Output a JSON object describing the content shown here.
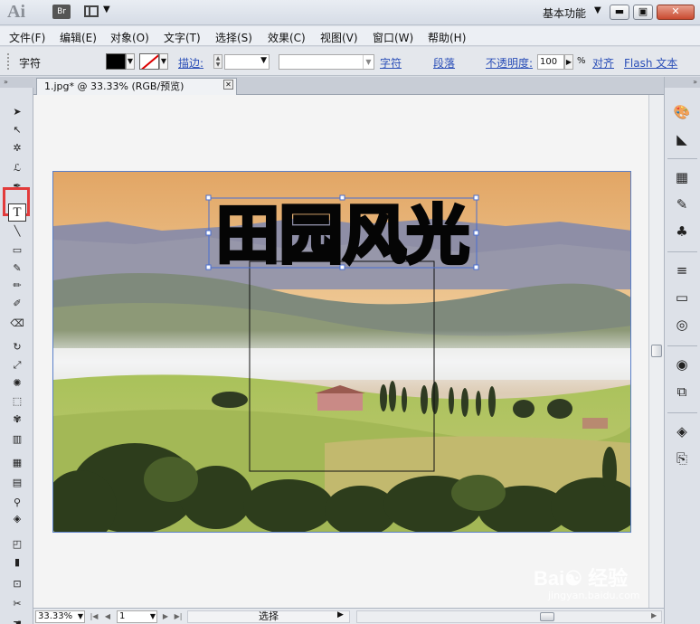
{
  "titlebar": {
    "app_logo": "Ai",
    "bridge_button": "Br",
    "layout_icon": "arrange-documents-icon",
    "workspace": "基本功能",
    "workspace_arrow": "▼",
    "minimize": "▬",
    "maximize": "▣",
    "close": "✕"
  },
  "menubar": {
    "items": [
      "文件(F)",
      "编辑(E)",
      "对象(O)",
      "文字(T)",
      "选择(S)",
      "效果(C)",
      "视图(V)",
      "窗口(W)",
      "帮助(H)"
    ]
  },
  "controlbar": {
    "label": "字符",
    "fill_color": "#000000",
    "stroke_color": "none",
    "stroke_label": "描边:",
    "stroke_weight": "",
    "font_family": "",
    "char_link": "字符",
    "para_link": "段落",
    "opacity_label": "不透明度:",
    "opacity_value": "100",
    "opacity_unit": "%",
    "align_link": "对齐",
    "flash_link": "Flash 文本"
  },
  "tools": {
    "header": "»",
    "items": [
      {
        "name": "selection-tool",
        "glyph": "➤"
      },
      {
        "name": "direct-selection-tool",
        "glyph": "↖"
      },
      {
        "name": "magic-wand-tool",
        "glyph": "✲"
      },
      {
        "name": "lasso-tool",
        "glyph": "ℒ"
      },
      {
        "name": "pen-tool",
        "glyph": "✒"
      },
      {
        "name": "type-tool",
        "glyph": "T"
      },
      {
        "name": "line-segment-tool",
        "glyph": "╲"
      },
      {
        "name": "rectangle-tool",
        "glyph": "▭"
      },
      {
        "name": "paintbrush-tool",
        "glyph": "✎"
      },
      {
        "name": "pencil-tool",
        "glyph": "✏"
      },
      {
        "name": "blob-brush-tool",
        "glyph": "✐"
      },
      {
        "name": "eraser-tool",
        "glyph": "⌫"
      },
      {
        "name": "rotate-tool",
        "glyph": "↻"
      },
      {
        "name": "scale-tool",
        "glyph": "⤢"
      },
      {
        "name": "warp-tool",
        "glyph": "✺"
      },
      {
        "name": "free-transform-tool",
        "glyph": "⬚"
      },
      {
        "name": "symbol-sprayer-tool",
        "glyph": "✾"
      },
      {
        "name": "column-graph-tool",
        "glyph": "▥"
      },
      {
        "name": "mesh-tool",
        "glyph": "▦"
      },
      {
        "name": "gradient-tool",
        "glyph": "▤"
      },
      {
        "name": "eyedropper-tool",
        "glyph": "⚲"
      },
      {
        "name": "blend-tool",
        "glyph": "◈"
      },
      {
        "name": "live-paint-bucket-tool",
        "glyph": "◰"
      },
      {
        "name": "graph-tool",
        "glyph": "▮"
      },
      {
        "name": "artboard-tool",
        "glyph": "⊡"
      },
      {
        "name": "slice-tool",
        "glyph": "✂"
      },
      {
        "name": "hand-tool",
        "glyph": "☚"
      }
    ]
  },
  "document": {
    "tab_title": "1.jpg* @ 33.33% (RGB/预览)",
    "tab_close": "✕",
    "artwork_text": "田园风光"
  },
  "panels": {
    "header": "»",
    "items": [
      {
        "name": "color-panel-icon",
        "glyph": "🎨"
      },
      {
        "name": "color-guide-panel-icon",
        "glyph": "◣"
      },
      {
        "name": "swatches-panel-icon",
        "glyph": "▦"
      },
      {
        "name": "brushes-panel-icon",
        "glyph": "✎"
      },
      {
        "name": "symbols-panel-icon",
        "glyph": "♣"
      },
      {
        "name": "stroke-panel-icon",
        "glyph": "≡"
      },
      {
        "name": "gradient-panel-icon",
        "glyph": "▭"
      },
      {
        "name": "transparency-panel-icon",
        "glyph": "◎"
      },
      {
        "name": "appearance-panel-icon",
        "glyph": "◉"
      },
      {
        "name": "graphic-styles-panel-icon",
        "glyph": "⧉"
      },
      {
        "name": "layers-panel-icon",
        "glyph": "◈"
      },
      {
        "name": "artboards-panel-icon",
        "glyph": "⎘"
      }
    ]
  },
  "statusbar": {
    "zoom": "33.33%",
    "page": "1",
    "status_text": "选择",
    "first": "|◀",
    "prev": "◀",
    "next": "▶",
    "last": "▶|"
  },
  "watermark": {
    "logo": "Bai☯ 经验",
    "url": "jingyan.baidu.com"
  }
}
